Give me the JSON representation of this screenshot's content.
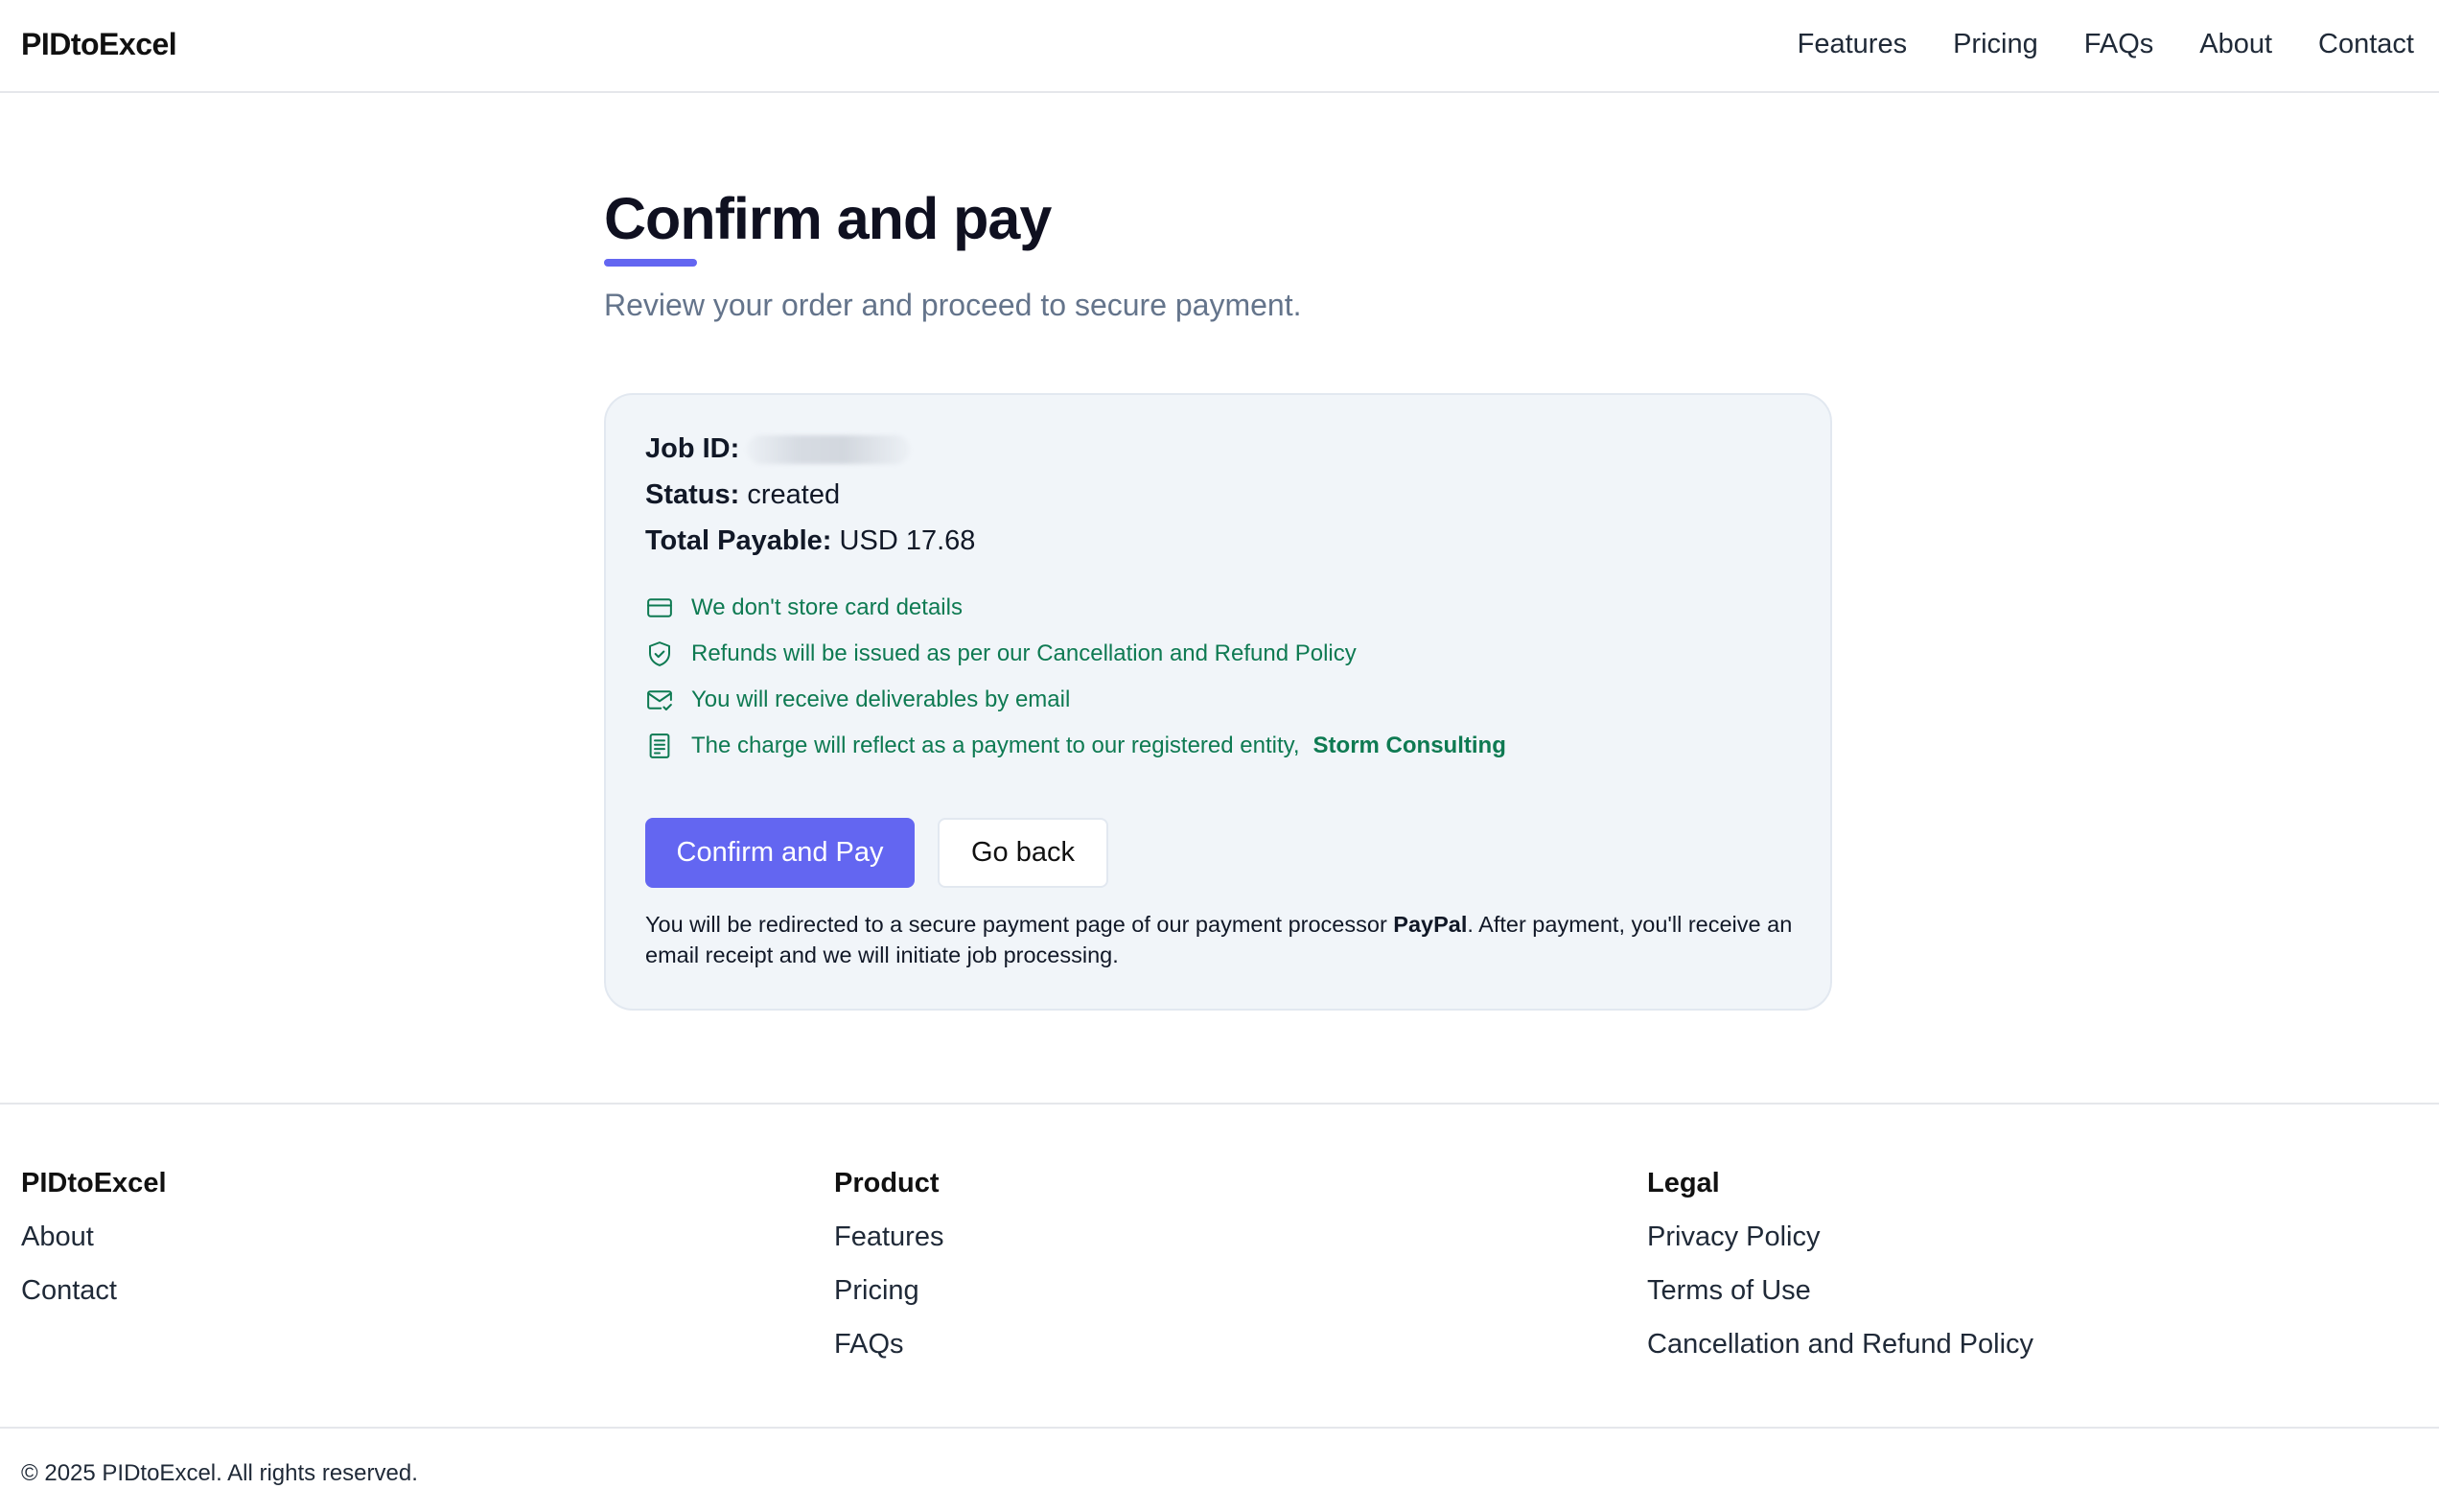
{
  "header": {
    "brand": "PIDtoExcel",
    "nav": [
      "Features",
      "Pricing",
      "FAQs",
      "About",
      "Contact"
    ]
  },
  "main": {
    "title": "Confirm and pay",
    "subtitle": "Review your order and proceed to secure payment."
  },
  "order": {
    "job_id_label": "Job ID:",
    "status_label": "Status:",
    "status_value": "created",
    "total_label": "Total Payable:",
    "total_value": "USD 17.68"
  },
  "features": [
    {
      "icon": "credit-card-icon",
      "text": "We don't store card details"
    },
    {
      "icon": "shield-check-icon",
      "text": "Refunds will be issued as per our Cancellation and Refund Policy"
    },
    {
      "icon": "mail-check-icon",
      "text": "You will receive deliverables by email"
    },
    {
      "icon": "receipt-icon",
      "text": "The charge will reflect as a payment to our registered entity,",
      "bold": "Storm Consulting"
    }
  ],
  "buttons": {
    "confirm": "Confirm and Pay",
    "back": "Go back"
  },
  "note": {
    "prefix": "You will be redirected to a secure payment page of our payment processor ",
    "processor": "PayPal",
    "suffix": ". After payment, you'll receive an email receipt and we will initiate job processing."
  },
  "footer": {
    "col1": {
      "heading": "PIDtoExcel",
      "links": [
        "About",
        "Contact"
      ]
    },
    "col2": {
      "heading": "Product",
      "links": [
        "Features",
        "Pricing",
        "FAQs"
      ]
    },
    "col3": {
      "heading": "Legal",
      "links": [
        "Privacy Policy",
        "Terms of Use",
        "Cancellation and Refund Policy"
      ]
    },
    "copyright": "© 2025 PIDtoExcel. All rights reserved."
  },
  "colors": {
    "accent": "#6366f1",
    "success_text": "#0e7a52",
    "card_bg": "#f1f5f9"
  }
}
